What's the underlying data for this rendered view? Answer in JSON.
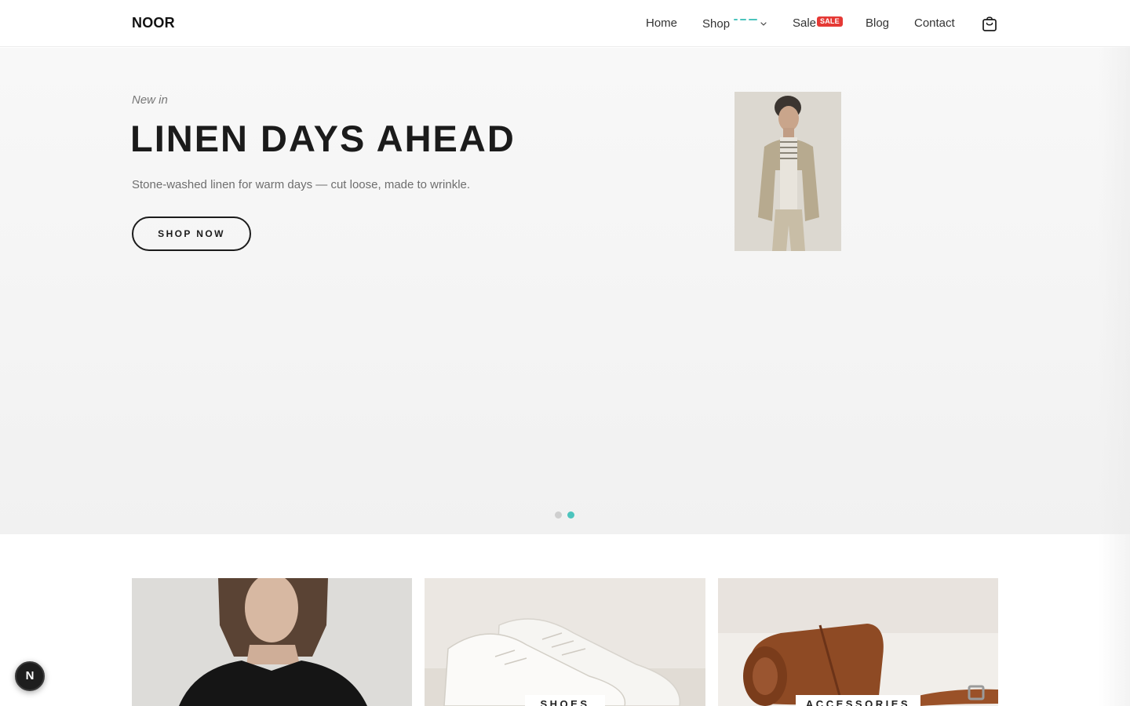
{
  "header": {
    "logo": "NOOR",
    "nav": {
      "home": "Home",
      "shop": "Shop",
      "sale": "Sale",
      "sale_badge": "SALE",
      "blog": "Blog",
      "contact": "Contact"
    },
    "icons": {
      "shop_dropdown": "chevron-down-icon",
      "cart": "shopping-bag-icon"
    }
  },
  "hero": {
    "kicker": "New in",
    "title": "LINEN DAYS AHEAD",
    "subtitle": "Stone-washed linen for warm days — cut loose, made to wrinkle.",
    "cta": "SHOP NOW",
    "slider": {
      "total_slides": 2,
      "active_slide": 2
    }
  },
  "categories": [
    {
      "label": ""
    },
    {
      "label": "SHOES"
    },
    {
      "label": "ACCESSORIES"
    }
  ],
  "dev_badge": {
    "label": "N"
  },
  "colors": {
    "accent": "#4cc4bd",
    "sale": "#e53935",
    "text": "#1b1b1b",
    "muted": "#6e6e6e",
    "dot_inactive": "#cfcfcf"
  }
}
